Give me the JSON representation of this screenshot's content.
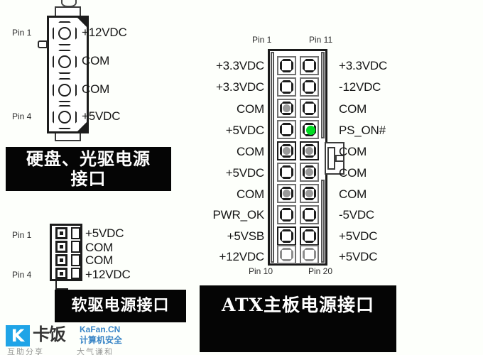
{
  "background_color": "#fdfffb",
  "molex_connector": {
    "name": "hard-drive-optical-drive-power-connector",
    "pin_first_label": "Pin 1",
    "pin_last_label": "Pin 4",
    "signals": [
      "+12VDC",
      "COM",
      "COM",
      "+5VDC"
    ],
    "caption": "硬盘、光驱电源接口"
  },
  "floppy_connector": {
    "name": "floppy-drive-power-connector",
    "pin_first_label": "Pin 1",
    "pin_last_label": "Pin 4",
    "signals": [
      "+5VDC",
      "COM",
      "COM",
      "+12VDC"
    ],
    "caption": "软驱电源接口"
  },
  "atx_connector": {
    "name": "atx-motherboard-power-connector",
    "top_left_label": "Pin 1",
    "top_right_label": "Pin 11",
    "bottom_left_label": "Pin 10",
    "bottom_right_label": "Pin 20",
    "caption": "ATX主板电源接口",
    "highlight_color": "#00dd22",
    "left_signals": [
      "+3.3VDC",
      "+3.3VDC",
      "COM",
      "+5VDC",
      "COM",
      "+5VDC",
      "COM",
      "PWR_OK",
      "+5VSB",
      "+12VDC"
    ],
    "right_signals": [
      "+3.3VDC",
      "-12VDC",
      "COM",
      "PS_ON#",
      "COM",
      "COM",
      "COM",
      "-5VDC",
      "+5VDC",
      "+5VDC"
    ],
    "left_pin_styles": [
      "empty",
      "empty",
      "wire",
      "empty",
      "wire-dark",
      "wire",
      "wire",
      "empty",
      "empty-dark",
      "pale"
    ],
    "right_pin_styles": [
      "empty",
      "empty",
      "empty",
      "green",
      "wire-dark",
      "wire",
      "wire",
      "empty",
      "empty-dark",
      "pale"
    ]
  },
  "watermark": {
    "logo_letter": "K",
    "logo_cn": "卡饭",
    "site_en": "KaFan.CN",
    "site_cn": "计算机安全",
    "slogan_left": "互助分享",
    "slogan_right": "大气谦和"
  }
}
